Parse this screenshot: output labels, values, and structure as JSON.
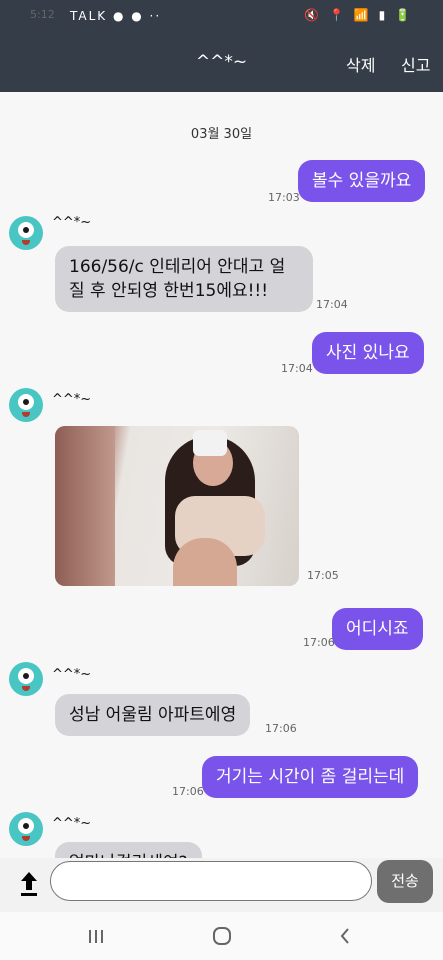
{
  "status": {
    "time": "5:12",
    "notifications": "TALK ● ● ··",
    "right": "🔇 📍 📶 ▮ 🔋"
  },
  "header": {
    "title": "^^*~",
    "delete_label": "삭제",
    "report_label": "신고"
  },
  "chat": {
    "date": "03월 30일",
    "nickname": "^^*~",
    "messages": [
      {
        "type": "out",
        "text": "볼수 있을까요",
        "time": "17:03"
      },
      {
        "type": "in",
        "text": "166/56/c 인테리어 안대고 얼질 후 안되영 한번15에요!!!",
        "time": "17:04"
      },
      {
        "type": "out",
        "text": "사진 있나요",
        "time": "17:04"
      },
      {
        "type": "in-photo",
        "time": "17:05"
      },
      {
        "type": "out",
        "text": "어디시죠",
        "time": "17:06"
      },
      {
        "type": "in",
        "text": "성남 어울림 아파트에영",
        "time": "17:06"
      },
      {
        "type": "out",
        "text": "거기는 시간이 좀 걸리는데",
        "time": "17:06"
      },
      {
        "type": "in-partial",
        "text": "얼마나걸리세여?"
      }
    ]
  },
  "composer": {
    "placeholder": "",
    "send_label": "전송"
  },
  "icons": {
    "upload": "upload-icon",
    "recent": "recent-apps-icon",
    "home": "home-icon",
    "back": "back-icon"
  }
}
